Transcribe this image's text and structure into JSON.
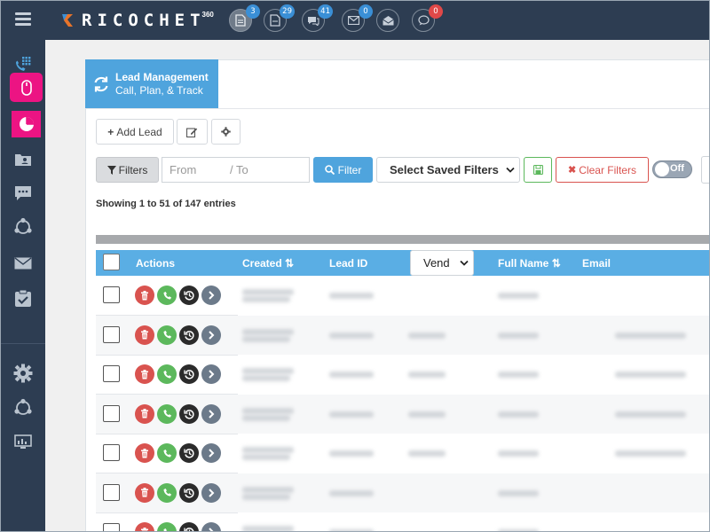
{
  "app": {
    "brand": "RICOCHET",
    "brand_sup": "360",
    "menu_icon": "hamburger-icon"
  },
  "notifications": [
    {
      "icon": "document-icon",
      "count": "3",
      "badge_color": "#3a8fd6"
    },
    {
      "icon": "file-icon",
      "count": "29",
      "badge_color": "#3a8fd6"
    },
    {
      "icon": "chat-icon",
      "count": "41",
      "badge_color": "#3a8fd6"
    },
    {
      "icon": "envelope-icon",
      "count": "0",
      "badge_color": "#3a8fd6"
    },
    {
      "icon": "open-mail-icon",
      "count": "",
      "badge_color": ""
    },
    {
      "icon": "speech-bubble-icon",
      "count": "0",
      "badge_color": "#e04848"
    }
  ],
  "sidebar": {
    "items": [
      "dialpad-icon",
      "mouse-icon",
      "pie-chart-icon",
      "contact-card-icon",
      "comment-icon",
      "network-icon",
      "mail-icon",
      "checklist-icon",
      "settings-icon",
      "share-network-icon",
      "monitor-icon"
    ]
  },
  "page": {
    "tab_title": "Lead Management",
    "tab_subtitle": "Call, Plan, & Track"
  },
  "toolbar": {
    "add_lead": "Add Lead",
    "filters": "Filters",
    "from_placeholder": "From",
    "to_placeholder": "/ To",
    "filter": "Filter",
    "saved_filters": "Select Saved Filters",
    "clear_filters": "Clear Filters",
    "toggle": "Off"
  },
  "table": {
    "showing": "Showing 1 to 51 of 147 entries",
    "columns": {
      "actions": "Actions",
      "created": "Created",
      "lead_id": "Lead ID",
      "vendor": "Vend",
      "full_name": "Full Name",
      "email": "Email"
    },
    "row_count": 7
  },
  "colors": {
    "nav": "#2d3d52",
    "accent": "#4fa4dd",
    "highlight": "#ec1483",
    "danger": "#d9534f",
    "success": "#5cb85c"
  }
}
